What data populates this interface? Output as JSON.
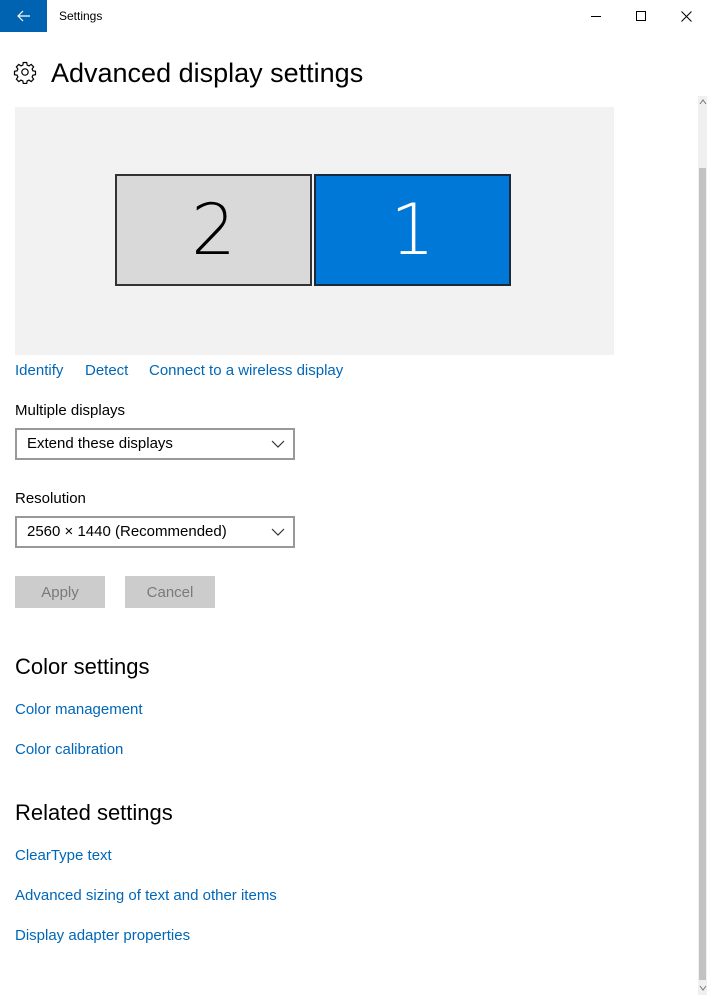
{
  "window": {
    "title": "Settings",
    "back_icon": "back-arrow-icon",
    "accent": "#0063b1"
  },
  "header": {
    "title": "Advanced display settings",
    "icon": "gear-icon"
  },
  "displays": {
    "monitors": [
      {
        "number": "2",
        "selected": false
      },
      {
        "number": "1",
        "selected": true
      }
    ],
    "selected_color": "#0078d7",
    "links": {
      "identify": "Identify",
      "detect": "Detect",
      "wireless": "Connect to a wireless display"
    }
  },
  "multiple_displays": {
    "label": "Multiple displays",
    "value": "Extend these displays"
  },
  "resolution": {
    "label": "Resolution",
    "value": "2560 × 1440 (Recommended)"
  },
  "buttons": {
    "apply": "Apply",
    "cancel": "Cancel"
  },
  "color_settings": {
    "title": "Color settings",
    "links": [
      "Color management",
      "Color calibration"
    ]
  },
  "related_settings": {
    "title": "Related settings",
    "links": [
      "ClearType text",
      "Advanced sizing of text and other items",
      "Display adapter properties"
    ]
  },
  "link_color": "#0067b8"
}
